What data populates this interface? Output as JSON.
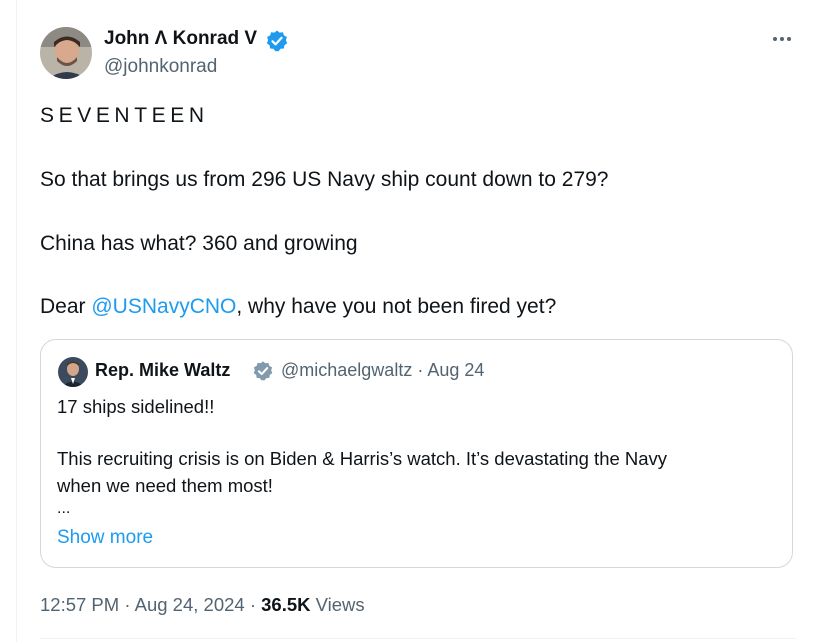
{
  "author": {
    "name": "John Λ Konrad V",
    "handle": "@johnkonrad",
    "verified_color": "#1d9bf0"
  },
  "tweet": {
    "lines": [
      "SEVENTEEN",
      "So that brings us from 296 US Navy ship count down to 279?",
      "China has what? 360 and growing"
    ],
    "last_prefix": "Dear ",
    "mention": "@USNavyCNO",
    "last_suffix": ", why have you not been fired yet?"
  },
  "quote": {
    "name": "Rep. Mike Waltz",
    "handle": "@michaelgwaltz",
    "separator": " · ",
    "date": "Aug 24",
    "badge_color": "#829aab",
    "lines": [
      "17 ships sidelined!!",
      "This recruiting crisis is on Biden & Harris’s watch. It’s devastating the Navy",
      "when we need them most!",
      "..."
    ],
    "show_more": "Show more"
  },
  "footer": {
    "time": "12:57 PM",
    "sep": " · ",
    "date": "Aug 24, 2024",
    "views_count": "36.5K",
    "views_label": "Views"
  },
  "icons": {
    "more": "more-horizontal-icon",
    "verified": "verified-badge-icon"
  }
}
